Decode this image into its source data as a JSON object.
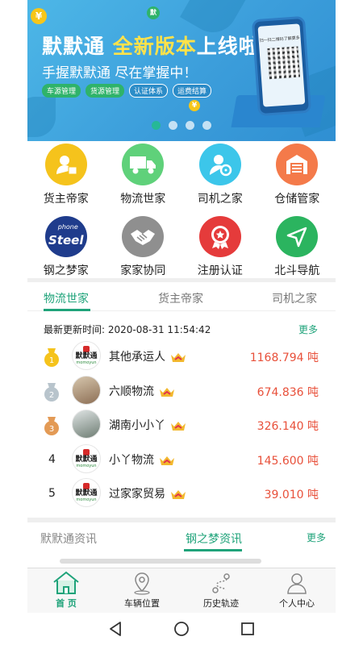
{
  "banner": {
    "title_pre": "默默通 ",
    "title_highlight": "全新版本",
    "title_post": "上线啦!",
    "subtitle": "手握默默通 尽在掌握中！",
    "tags": [
      "车源管理",
      "货源管理",
      "认证体系",
      "运费结算"
    ],
    "phone_caption": "扫一扫二维码了解更多",
    "dots": 4,
    "active_dot": 0
  },
  "grid": [
    {
      "label": "货主帝家",
      "icon": "cargo-owner-icon",
      "color": "#f5c31c"
    },
    {
      "label": "物流世家",
      "icon": "truck-icon",
      "color": "#5fd17a"
    },
    {
      "label": "司机之家",
      "icon": "driver-icon",
      "color": "#3cc6ea"
    },
    {
      "label": "仓储管家",
      "icon": "warehouse-icon",
      "color": "#f47a4a"
    },
    {
      "label": "钢之梦家",
      "icon": "steel-phone-logo-icon",
      "color": "#1f3c8c",
      "logo_text": "Steel",
      "logo_small": "phone"
    },
    {
      "label": "家家协同",
      "icon": "handshake-icon",
      "color": "#8f8f8f"
    },
    {
      "label": "注册认证",
      "icon": "certified-badge-icon",
      "color": "#e53b3b"
    },
    {
      "label": "北斗导航",
      "icon": "navigation-arrow-icon",
      "color": "#2bb45f"
    }
  ],
  "ranking": {
    "tabs": [
      "物流世家",
      "货主帝家",
      "司机之家"
    ],
    "active_tab": 0,
    "update_label": "最新更新时间:",
    "update_time": "2020-08-31 11:54:42",
    "more": "更多",
    "rows": [
      {
        "rank": "1",
        "name": "其他承运人",
        "amount": "1168.794 吨",
        "avatar": "logo",
        "medal": "#f5c31c"
      },
      {
        "rank": "2",
        "name": "六顺物流",
        "amount": "674.836 吨",
        "avatar": "photo",
        "medal": "#b8c4cc"
      },
      {
        "rank": "3",
        "name": "湖南小小丫",
        "amount": "326.140 吨",
        "avatar": "photo2",
        "medal": "#e39a55"
      },
      {
        "rank": "4",
        "name": "小丫物流",
        "amount": "145.600 吨",
        "avatar": "logo"
      },
      {
        "rank": "5",
        "name": "过家家贸易",
        "amount": "39.010 吨",
        "avatar": "logo"
      }
    ],
    "avatar_logo_text": "默默通",
    "avatar_logo_small": "momoyun"
  },
  "news": {
    "tabs": [
      "默默通资讯",
      "钢之梦资讯"
    ],
    "active_tab": 1,
    "more": "更多"
  },
  "bottom_nav": [
    {
      "label": "首 页",
      "icon": "home-icon",
      "active": true
    },
    {
      "label": "车辆位置",
      "icon": "location-pin-icon",
      "active": false
    },
    {
      "label": "历史轨迹",
      "icon": "route-track-icon",
      "active": false
    },
    {
      "label": "个人中心",
      "icon": "user-profile-icon",
      "active": false
    }
  ],
  "system_nav": [
    "back-triangle-icon",
    "home-circle-icon",
    "recents-square-icon"
  ],
  "colors": {
    "accent": "#1fa37a",
    "amount": "#e8503a",
    "gold": "#f5c31c"
  }
}
